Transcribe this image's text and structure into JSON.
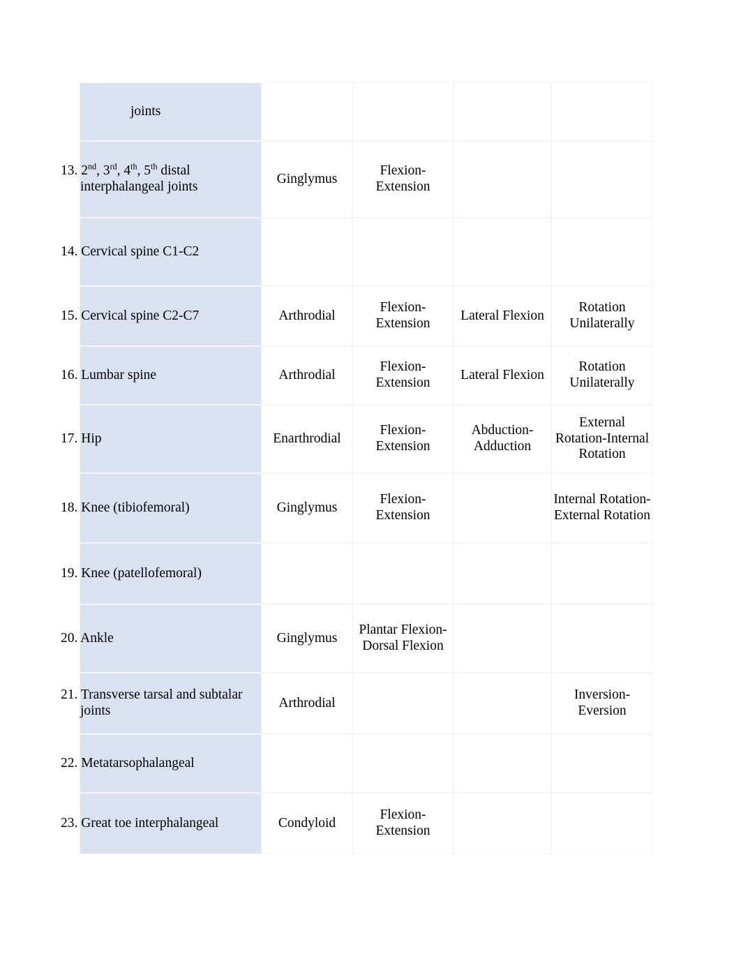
{
  "document": {
    "type": "table",
    "colors": {
      "label_column_fill": "#dae2f1",
      "data_cell_fill": "#ffffff",
      "border": "#f4f5f7",
      "page_background": "#ffffff",
      "text": "#000000"
    }
  },
  "table": {
    "column_count": 5,
    "rows": [
      {
        "id": "row-continuation-joints",
        "continuation": true,
        "name_html": "joints",
        "name_text": "joints",
        "classification": "",
        "movement_1": "",
        "movement_2": "",
        "movement_3": ""
      },
      {
        "id": "row-13",
        "continuation": false,
        "number": "13.",
        "name_html": "13. 2<sup>nd</sup>, 3<sup>rd</sup>, 4<sup>th</sup>, 5<sup>th</sup> distal interphalangeal joints",
        "name_text": "13. 2nd, 3rd, 4th, 5th distal interphalangeal joints",
        "classification": "Ginglymus",
        "movement_1": "Flexion-Extension",
        "movement_2": "",
        "movement_3": ""
      },
      {
        "id": "row-14",
        "continuation": false,
        "number": "14.",
        "name_html": "14. Cervical spine C1-C2",
        "name_text": "14. Cervical spine C1-C2",
        "classification": "",
        "movement_1": "",
        "movement_2": "",
        "movement_3": ""
      },
      {
        "id": "row-15",
        "continuation": false,
        "number": "15.",
        "name_html": "15. Cervical spine C2-C7",
        "name_text": "15. Cervical spine C2-C7",
        "classification": "Arthrodial",
        "movement_1": "Flexion-Extension",
        "movement_2": "Lateral Flexion",
        "movement_3": "Rotation Unilaterally"
      },
      {
        "id": "row-16",
        "continuation": false,
        "number": "16.",
        "name_html": "16. Lumbar spine",
        "name_text": "16. Lumbar spine",
        "classification": "Arthrodial",
        "movement_1": "Flexion-Extension",
        "movement_2": "Lateral Flexion",
        "movement_3": "Rotation Unilaterally"
      },
      {
        "id": "row-17",
        "continuation": false,
        "number": "17.",
        "name_html": "17. Hip",
        "name_text": "17. Hip",
        "classification": "Enarthrodial",
        "movement_1": "Flexion-Extension",
        "movement_2": "Abduction-Adduction",
        "movement_3": "External Rotation-Internal Rotation"
      },
      {
        "id": "row-18",
        "continuation": false,
        "number": "18.",
        "name_html": "18. Knee (tibiofemoral)",
        "name_text": "18. Knee (tibiofemoral)",
        "classification": "Ginglymus",
        "movement_1": "Flexion-Extension",
        "movement_2": "",
        "movement_3": "Internal Rotation-External Rotation"
      },
      {
        "id": "row-19",
        "continuation": false,
        "number": "19.",
        "name_html": "19. Knee (patellofemoral)",
        "name_text": "19. Knee (patellofemoral)",
        "classification": "",
        "movement_1": "",
        "movement_2": "",
        "movement_3": ""
      },
      {
        "id": "row-20",
        "continuation": false,
        "number": "20.",
        "name_html": "20. Ankle",
        "name_text": "20. Ankle",
        "classification": "Ginglymus",
        "movement_1": "Plantar Flexion-Dorsal Flexion",
        "movement_2": "",
        "movement_3": ""
      },
      {
        "id": "row-21",
        "continuation": false,
        "number": "21.",
        "name_html": "21. Transverse tarsal and subtalar joints",
        "name_text": "21. Transverse tarsal and subtalar joints",
        "classification": "Arthrodial",
        "movement_1": "",
        "movement_2": "",
        "movement_3": "Inversion-Eversion"
      },
      {
        "id": "row-22",
        "continuation": false,
        "number": "22.",
        "name_html": "22. Metatarsophalangeal",
        "name_text": "22. Metatarsophalangeal",
        "classification": "",
        "movement_1": "",
        "movement_2": "",
        "movement_3": ""
      },
      {
        "id": "row-23",
        "continuation": false,
        "number": "23.",
        "name_html": "23. Great toe interphalangeal",
        "name_text": "23. Great toe interphalangeal",
        "classification": "Condyloid",
        "movement_1": "Flexion-Extension",
        "movement_2": "",
        "movement_3": ""
      }
    ]
  }
}
